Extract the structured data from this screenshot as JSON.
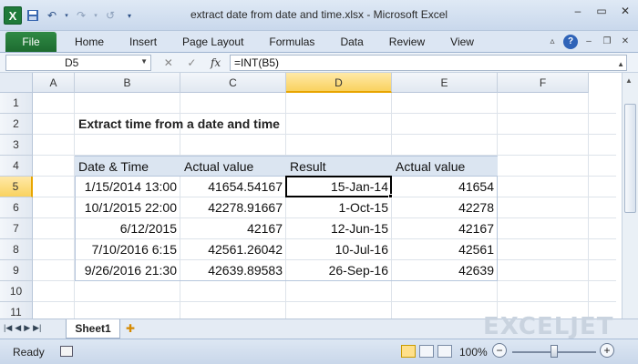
{
  "window": {
    "title": "extract date from date and time.xlsx - Microsoft Excel"
  },
  "ribbon": {
    "file_label": "File",
    "tabs": [
      "Home",
      "Insert",
      "Page Layout",
      "Formulas",
      "Data",
      "Review",
      "View"
    ]
  },
  "formula_bar": {
    "name_box": "D5",
    "fx_label": "fx",
    "formula": "=INT(B5)"
  },
  "grid": {
    "columns": [
      "A",
      "B",
      "C",
      "D",
      "E",
      "F"
    ],
    "rows": [
      "1",
      "2",
      "3",
      "4",
      "5",
      "6",
      "7",
      "8",
      "9",
      "10",
      "11"
    ],
    "active_column": "D",
    "active_row": "5"
  },
  "sheet_title": "Extract time from a date and time",
  "table": {
    "headers": [
      "Date & Time",
      "Actual value",
      "Result",
      "Actual value"
    ],
    "rows": [
      [
        "1/15/2014 13:00",
        "41654.54167",
        "15-Jan-14",
        "41654"
      ],
      [
        "10/1/2015 22:00",
        "42278.91667",
        "1-Oct-15",
        "42278"
      ],
      [
        "6/12/2015",
        "42167",
        "12-Jun-15",
        "42167"
      ],
      [
        "7/10/2016 6:15",
        "42561.26042",
        "10-Jul-16",
        "42561"
      ],
      [
        "9/26/2016 21:30",
        "42639.89583",
        "26-Sep-16",
        "42639"
      ]
    ]
  },
  "sheets": {
    "active": "Sheet1"
  },
  "status": {
    "mode": "Ready",
    "zoom": "100%",
    "zoom_fraction": 0.5
  },
  "watermark": {
    "brand": "EXCELJET"
  },
  "colors": {
    "accent": "#1f7a3a",
    "header_fill": "#dbe5f1",
    "active_header": "#f9d25f"
  }
}
